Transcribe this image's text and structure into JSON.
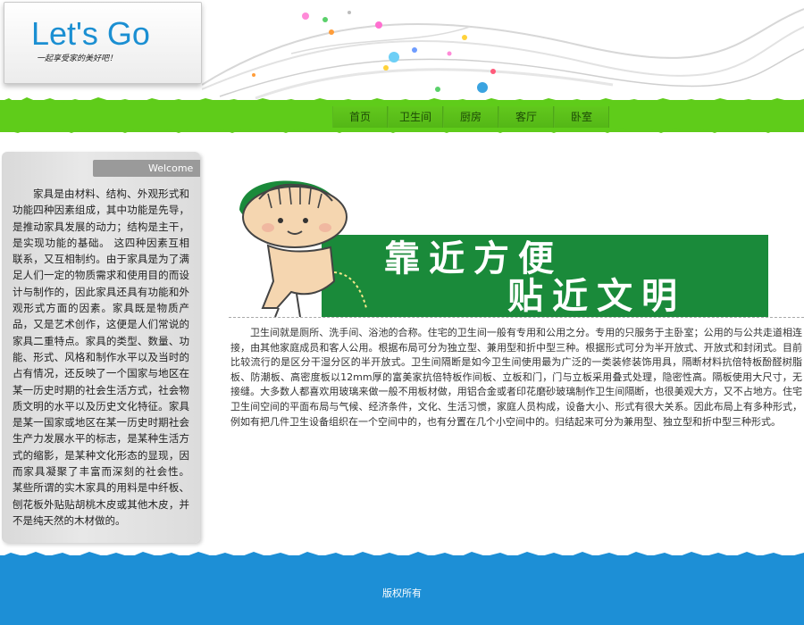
{
  "logo": {
    "title": "Let's Go",
    "slogan": "一起享受家的美好吧！"
  },
  "nav": {
    "items": [
      {
        "label": "首页"
      },
      {
        "label": "卫生间"
      },
      {
        "label": "厨房"
      },
      {
        "label": "客厅"
      },
      {
        "label": "卧室"
      }
    ]
  },
  "sidebar": {
    "tab_label": "Welcome",
    "text": "家具是由材料、结构、外观形式和功能四种因素组成，其中功能是先导，是推动家具发展的动力；结构是主干，是实现功能的基础。 这四种因素互相联系，又互相制约。由于家具是为了满足人们一定的物质需求和使用目的而设计与制作的，因此家具还具有功能和外观形式方面的因素。家具既是物质产品，又是艺术创作，这便是人们常说的家具二重特点。家具的类型、数量、功能、形式、风格和制作水平以及当时的占有情况，还反映了一个国家与地区在某一历史时期的社会生活方式，社会物质文明的水平以及历史文化特征。家具是某一国家或地区在某一历史时期社会生产力发展水平的标志，是某种生活方式的缩影，是某种文化形态的显现，因而家具凝聚了丰富而深刻的社会性。 某些所谓的实木家具的用料是中纤板、刨花板外贴贴胡桃木皮或其他木皮，并不是纯天然的木材做的。"
  },
  "banner": {
    "line1": "靠近方便",
    "line2": "贴近文明",
    "colors": {
      "green": "#1a8a3a",
      "text": "#ffffff"
    }
  },
  "main": {
    "text": "卫生间就是厕所、洗手间、浴池的合称。住宅的卫生间一般有专用和公用之分。专用的只服务于主卧室；公用的与公共走道相连接，由其他家庭成员和客人公用。根据布局可分为独立型、兼用型和折中型三种。根据形式可分为半开放式、开放式和封闭式。目前比较流行的是区分干湿分区的半开放式。卫生间隔断是如今卫生间使用最为广泛的一类装修装饰用具，隔断材料抗倍特板酚醛树脂板、防潮板、高密度板以12mm厚的富美家抗倍特板作间板、立板和门，门与立板采用叠式处理，隐密性高。隔板使用大尺寸，无接缝。大多数人都喜欢用玻璃来做一般不用板材做，用铝合金或者印花磨砂玻璃制作卫生间隔断，也很美观大方，又不占地方。住宅卫生间空间的平面布局与气候、经济条件，文化、生活习惯，家庭人员构成，设备大小、形式有很大关系。因此布局上有多种形式，例如有把几件卫生设备组织在一个空间中的，也有分置在几个小空间中的。归结起来可分为兼用型、独立型和折中型三种形式。"
  },
  "footer": {
    "text": "版权所有"
  },
  "colors": {
    "nav_green": "#5fcc1a",
    "footer_blue": "#1d8fd6",
    "logo_blue": "#1b8fd2"
  }
}
